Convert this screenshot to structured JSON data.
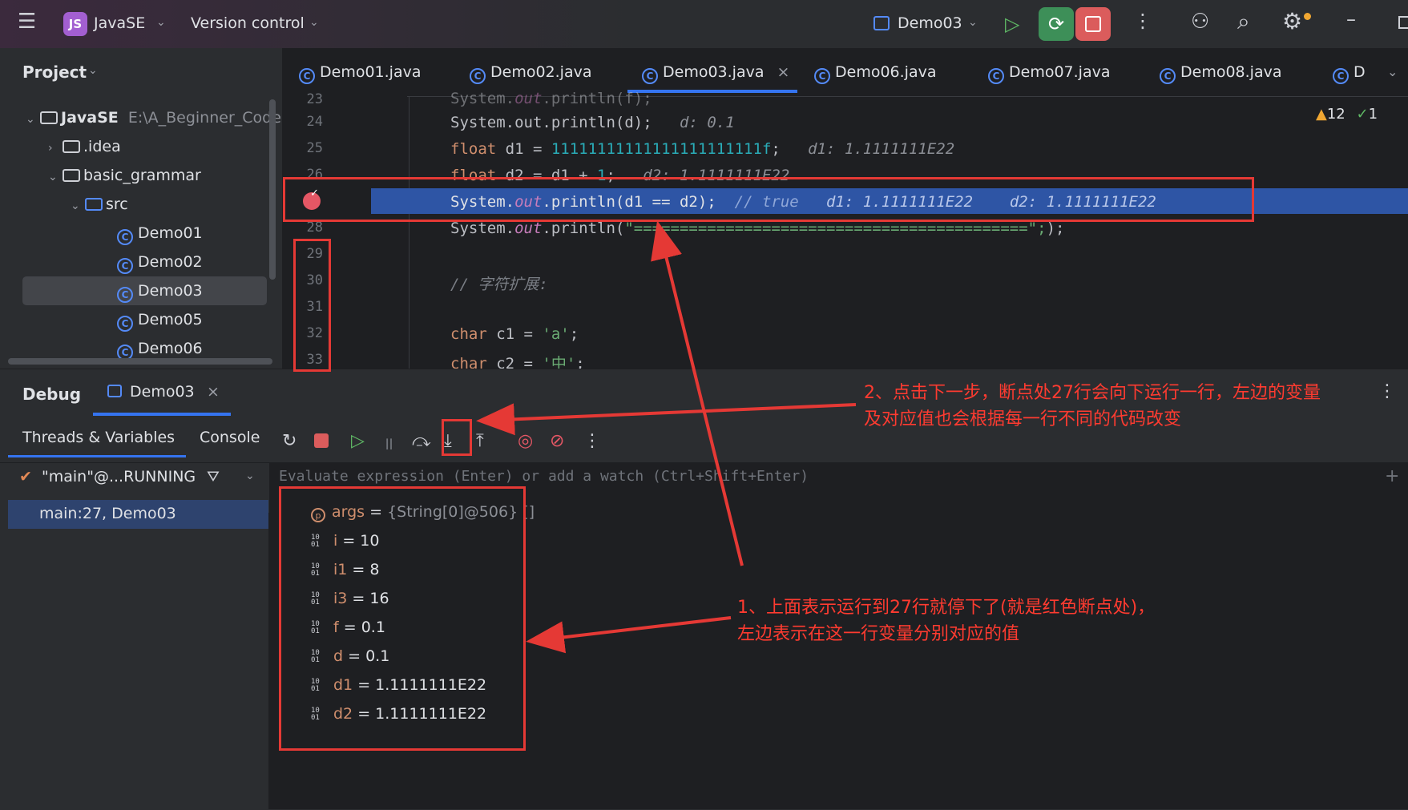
{
  "titlebar": {
    "project_badge": "JS",
    "project_name": "JavaSE",
    "vcs": "Version control",
    "run_config": "Demo03"
  },
  "project_panel": {
    "title": "Project",
    "root_name": "JavaSE",
    "root_path": "E:\\A_Beginner_Code",
    "items": [
      {
        "label": ".idea"
      },
      {
        "label": "basic_grammar"
      },
      {
        "label": "src"
      },
      {
        "label": "Demo01"
      },
      {
        "label": "Demo02"
      },
      {
        "label": "Demo03"
      },
      {
        "label": "Demo05"
      },
      {
        "label": "Demo06"
      }
    ]
  },
  "editor": {
    "tabs": [
      "Demo01.java",
      "Demo02.java",
      "Demo03.java",
      "Demo06.java",
      "Demo07.java",
      "Demo08.java",
      "D"
    ],
    "active_tab": "Demo03.java",
    "warnings": "12",
    "checks": "1",
    "line_numbers": [
      "23",
      "24",
      "25",
      "26",
      "27",
      "28",
      "29",
      "30",
      "31",
      "32",
      "33"
    ],
    "lines": {
      "l24_code": "System.out.println(d);",
      "l24_hint": "d: 0.1",
      "l25_code": "float d1 = 11111111111111111111111f;",
      "l25_hint": "d1: 1.1111111E22",
      "l26_code": "float d2 = d1 + 1;",
      "l26_hint": "d2: 1.1111111E22",
      "l27_code": "System.out.println(d1 == d2);",
      "l27_comment": "// true",
      "l27_hint1": "d1: 1.1111111E22",
      "l27_hint2": "d2: 1.1111111E22",
      "l28_code": "System.out.println(\"===========================================\");",
      "l30_comment": "// 字符扩展:",
      "l32_code": "char c1 = 'a';",
      "l33_code": "char c2 = '中';"
    }
  },
  "debug": {
    "title": "Debug",
    "session_tab": "Demo03",
    "subtab_threads": "Threads & Variables",
    "subtab_console": "Console",
    "thread_label": "\"main\"@...RUNNING",
    "frame": "main:27, Demo03",
    "evaluate_placeholder": "Evaluate expression (Enter) or add a watch (Ctrl+Shift+Enter)",
    "variables": [
      {
        "name": "args",
        "eq": " = ",
        "value": "{String[0]@506} []"
      },
      {
        "name": "i",
        "eq": " = ",
        "value": "10"
      },
      {
        "name": "i1",
        "eq": " = ",
        "value": "8"
      },
      {
        "name": "i3",
        "eq": " = ",
        "value": "16"
      },
      {
        "name": "f",
        "eq": " = ",
        "value": "0.1"
      },
      {
        "name": "d",
        "eq": " = ",
        "value": "0.1"
      },
      {
        "name": "d1",
        "eq": " = ",
        "value": "1.1111111E22"
      },
      {
        "name": "d2",
        "eq": " = ",
        "value": "1.1111111E22"
      }
    ]
  },
  "annotations": {
    "note2_line1": "2、点击下一步，断点处27行会向下运行一行，左边的变量",
    "note2_line2": "及对应值也会根据每一行不同的代码改变",
    "note1_line1": "1、上面表示运行到27行就停下了(就是红色断点处)，",
    "note1_line2": "左边表示在这一行变量分别对应的值"
  },
  "colors": {
    "accent": "#3574f0",
    "highlight_row": "#2e55a5",
    "annotation_red": "#e53935"
  }
}
